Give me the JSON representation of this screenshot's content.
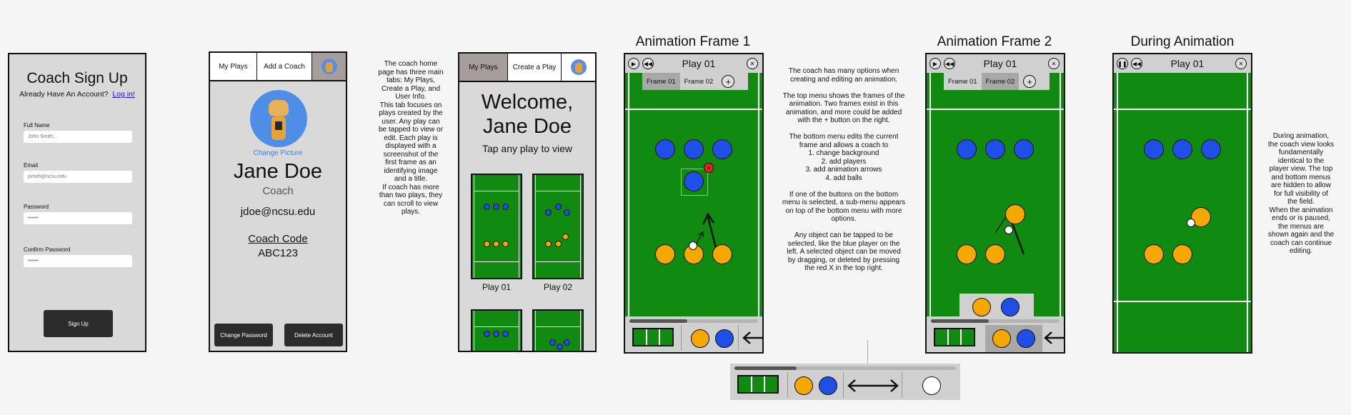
{
  "signup": {
    "title": "Coach Sign Up",
    "already": "Already Have An Account?",
    "login_link": "Log in!",
    "full_name_label": "Full Name",
    "full_name_placeholder": "John Smith...",
    "email_label": "Email",
    "email_placeholder": "jsmith@ncsu.edu",
    "password_label": "Password",
    "password_placeholder": "••••••",
    "confirm_label": "Confirm Password",
    "confirm_placeholder": "••••••",
    "signup_button": "Sign Up"
  },
  "profile": {
    "tabs": [
      "My Plays",
      "Add a Coach"
    ],
    "change_picture": "Change Picture",
    "name": "Jane Doe",
    "role": "Coach",
    "email": "jdoe@ncsu.edu",
    "coach_code_label": "Coach Code",
    "coach_code": "ABC123",
    "change_password": "Change Password",
    "delete_account": "Delete Account"
  },
  "note_home": "The coach home\npage has three main\ntabs: My Plays,\nCreate a Play, and\nUser Info.\nThis tab focuses on\nplays created by the\nuser. Any play can\nbe tapped to view or\nedit. Each play is\ndisplayed with a\nscreenshot of the\nfirst frame as an\nidentifying image\nand a title.\nIf coach has more\nthan two plays, they\ncan scroll to view\nplays.",
  "myplays": {
    "tabs": [
      "My Plays",
      "Create a Play"
    ],
    "welcome_1": "Welcome,",
    "welcome_2": "Jane Doe",
    "subtitle": "Tap any play to view",
    "play1": "Play 01",
    "play2": "Play 02"
  },
  "frame1": {
    "heading": "Animation Frame 1",
    "play_title": "Play 01",
    "frame_tabs": [
      "Frame 01",
      "Frame 02"
    ]
  },
  "note_editor": "The coach has many options when\ncreating and editing an animation.\n\nThe top menu shows the frames of the\nanimation. Two frames exist in this\nanimation, and more could be added\nwith the + button on the right.\n\nThe bottom menu edits the current\nframe and allows a coach to\n1. change background\n2. add players\n3. add animation arrows\n4. add balls\n\nIf one of the buttons on the bottom\nmenu is selected, a sub-menu appears\non top of the bottom menu with more\noptions.\n\nAny object can be tapped to be\nselected, like the blue player on the\nleft. A selected object can be moved\nby dragging, or deleted by pressing\nthe red X in the top right.",
  "frame2": {
    "heading": "Animation Frame 2",
    "play_title": "Play 01",
    "frame_tabs": [
      "Frame 01",
      "Frame 02"
    ]
  },
  "during": {
    "heading": "During Animation",
    "play_title": "Play 01"
  },
  "note_during": "During animation,\nthe coach view looks\nfundamentally\nidentical to the\nplayer view. The top\nand bottom menus\nare hidden to allow\nfor full visibility of\nthe field.\nWhen the animation\nends or is paused,\nthe menus are\nshown again and the\ncoach can continue\nediting.",
  "colors": {
    "field": "#118a11",
    "player_blue": "#1f4fe6",
    "player_orange": "#f5a800",
    "selected_tab": "#a69d9d",
    "dark_button": "#2c2c2c"
  }
}
